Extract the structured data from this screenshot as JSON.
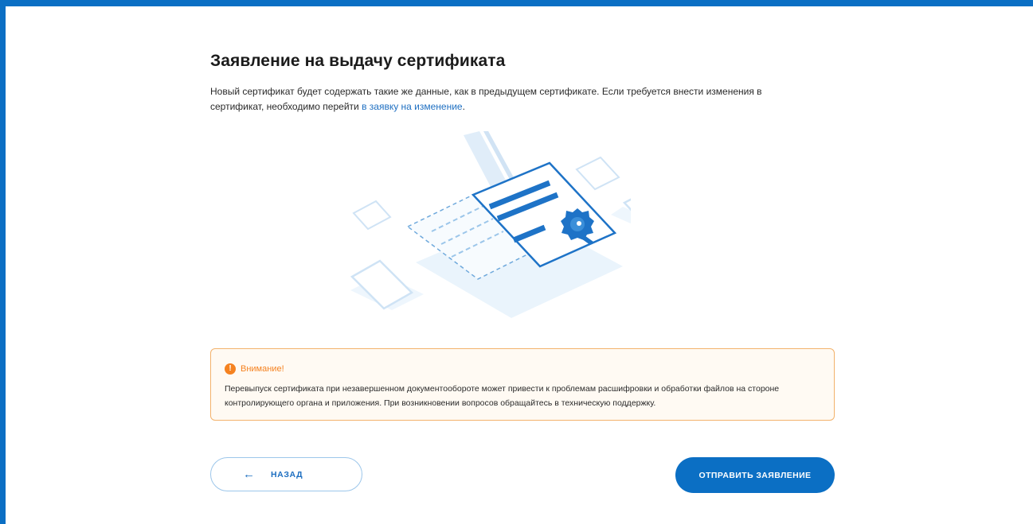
{
  "page": {
    "title": "Заявление на выдачу сертификата",
    "intro_text": "Новый сертификат будет содержать такие же данные, как в предыдущем сертификате. Если требуется внести изменения в сертификат, необходимо перейти ",
    "intro_link": "в заявку на изменение",
    "intro_end": "."
  },
  "illustration": {
    "icon": "certificate-illustration"
  },
  "alert": {
    "icon": "exclamation-icon",
    "title": "Внимание!",
    "body": "Перевыпуск сертификата при незавершенном документообороте может привести к проблемам расшифровки и обработки файлов на стороне контролирующего органа и приложения. При возникновении вопросов обращайтесь в техническую поддержку.",
    "border_color": "#f3b26b",
    "accent_color": "#f58220"
  },
  "actions": {
    "back_label": "НАЗАД",
    "back_icon": "arrow-left-icon",
    "submit_label": "ОТПРАВИТЬ ЗАЯВЛЕНИЕ"
  },
  "colors": {
    "brand": "#0b6fc4",
    "link": "#1e6fc1"
  }
}
